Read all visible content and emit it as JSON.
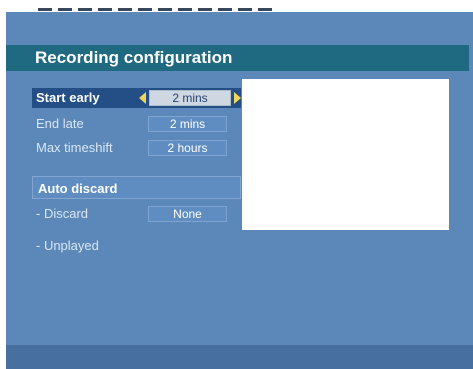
{
  "screen": {
    "title": "Recording configuration"
  },
  "settings": {
    "start_early": {
      "label": "Start early",
      "value": "2 mins"
    },
    "end_late": {
      "label": "End late",
      "value": "2 mins"
    },
    "max_timeshift": {
      "label": "Max timeshift",
      "value": "2 hours"
    }
  },
  "auto_discard": {
    "label": "Auto discard",
    "discard": {
      "label": "- Discard",
      "value": "None"
    },
    "unplayed": {
      "label": "- Unplayed"
    }
  },
  "colors": {
    "background": "#5b88b9",
    "title_bar": "#1f6a80",
    "selected_row": "#234f86",
    "value_box": "#5f8dc1",
    "highlight_value": "#cfd7e2",
    "arrow": "#f1d45b",
    "preview": "#ffffff"
  },
  "icons": {
    "left_arrow": "left-arrow-icon",
    "right_arrow": "right-arrow-icon"
  }
}
